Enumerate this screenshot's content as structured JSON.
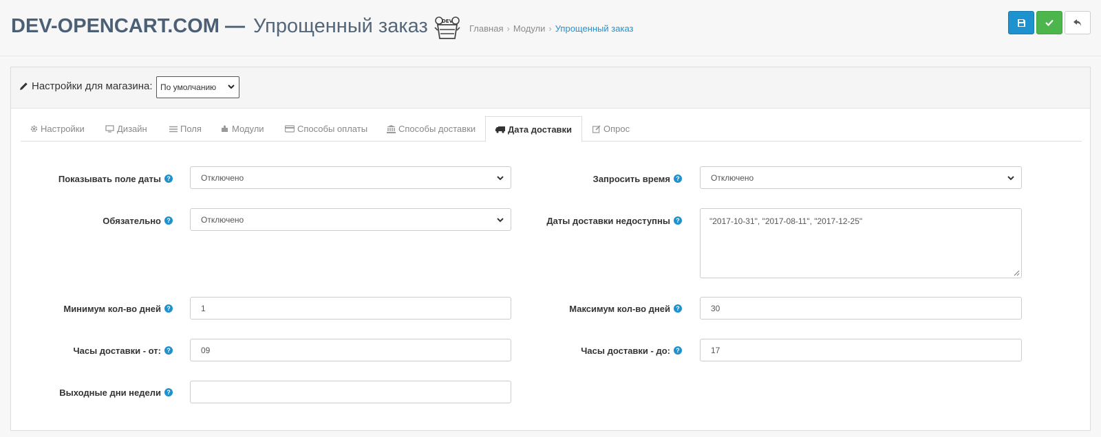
{
  "header": {
    "brand": "DEV-OPENCART.COM",
    "dash": "—",
    "title": "Упрощенный заказ",
    "logo_text": "DEV",
    "breadcrumb": [
      "Главная",
      "Модули",
      "Упрощенный заказ"
    ],
    "buttons": [
      "save-icon",
      "check-icon",
      "reply-icon"
    ]
  },
  "store": {
    "label": "Настройки для магазина:",
    "selected": "По умолчанию"
  },
  "tabs": [
    {
      "label": "Настройки",
      "icon": "gear-icon"
    },
    {
      "label": "Дизайн",
      "icon": "monitor-icon"
    },
    {
      "label": "Поля",
      "icon": "list-icon"
    },
    {
      "label": "Модули",
      "icon": "puzzle-icon"
    },
    {
      "label": "Способы оплаты",
      "icon": "credit-card-icon"
    },
    {
      "label": "Способы доставки",
      "icon": "bank-icon"
    },
    {
      "label": "Дата доставки",
      "icon": "truck-icon",
      "active": true
    },
    {
      "label": "Опрос",
      "icon": "edit-icon"
    }
  ],
  "form": {
    "show_date": {
      "label": "Показывать поле даты",
      "value": "Отключено"
    },
    "request_time": {
      "label": "Запросить время",
      "value": "Отключено"
    },
    "required": {
      "label": "Обязательно",
      "value": "Отключено"
    },
    "unavailable_dates": {
      "label": "Даты доставки недоступны",
      "value": "\"2017-10-31\", \"2017-08-11\", \"2017-12-25\""
    },
    "min_days": {
      "label": "Минимум кол-во дней",
      "value": "1"
    },
    "max_days": {
      "label": "Максимум кол-во дней",
      "value": "30"
    },
    "hours_from": {
      "label": "Часы доставки - от:",
      "value": "09"
    },
    "hours_to": {
      "label": "Часы доставки - до:",
      "value": "17"
    },
    "weekends": {
      "label": "Выходные дни недели",
      "value": ""
    }
  },
  "colors": {
    "primary": "#1e91cf",
    "success": "#4cb64c",
    "brand_text": "#4b5f75"
  }
}
